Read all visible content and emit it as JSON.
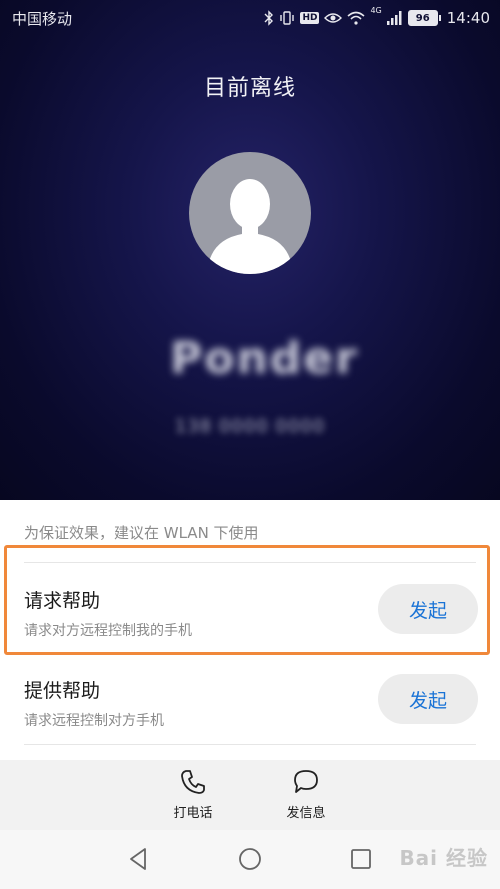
{
  "status_bar": {
    "carrier": "中国移动",
    "network": "4G",
    "hd_badge": "HD",
    "battery": "96",
    "time": "14:40"
  },
  "header": {
    "title": "目前离线"
  },
  "contact": {
    "avatar_icon": "person-silhouette-icon",
    "name": "Ponder",
    "number": "138 0000 0000"
  },
  "sheet": {
    "hint": "为保证效果，建议在 WLAN 下使用",
    "options": [
      {
        "title": "请求帮助",
        "subtitle": "请求对方远程控制我的手机",
        "button": "发起"
      },
      {
        "title": "提供帮助",
        "subtitle": "请求远程控制对方手机",
        "button": "发起"
      }
    ]
  },
  "actions": {
    "call_label": "打电话",
    "message_label": "发信息"
  },
  "watermark": "Bai 经验",
  "colors": {
    "accent": "#1a73d6",
    "highlight": "#f0883a",
    "hero_bg": "#0a0a2c"
  }
}
